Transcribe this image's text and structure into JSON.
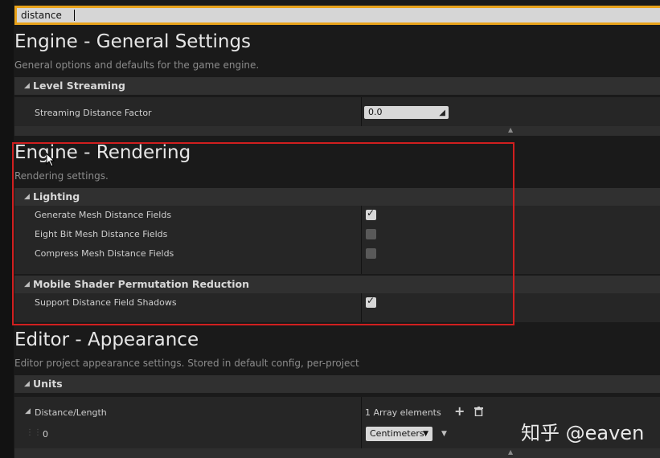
{
  "search": {
    "value": "distance"
  },
  "sections": [
    {
      "title": "Engine - General Settings",
      "description": "General options and defaults for the game engine.",
      "categories": [
        {
          "name": "Level Streaming",
          "rows": [
            {
              "label": "Streaming Distance Factor",
              "value": "0.0"
            }
          ]
        }
      ]
    },
    {
      "title": "Engine - Rendering",
      "description": "Rendering settings.",
      "categories": [
        {
          "name": "Lighting",
          "rows": [
            {
              "label": "Generate Mesh Distance Fields",
              "checked": true
            },
            {
              "label": "Eight Bit Mesh Distance Fields",
              "checked": false
            },
            {
              "label": "Compress Mesh Distance Fields",
              "checked": false
            }
          ]
        },
        {
          "name": "Mobile Shader Permutation Reduction",
          "rows": [
            {
              "label": "Support Distance Field Shadows",
              "checked": true
            }
          ]
        }
      ]
    },
    {
      "title": "Editor - Appearance",
      "description": "Editor project appearance settings. Stored in default config, per-project",
      "categories": [
        {
          "name": "Units",
          "rows": [
            {
              "label": "Distance/Length",
              "value": "1 Array elements"
            },
            {
              "label": "0",
              "value": "Centimeters"
            }
          ]
        }
      ]
    }
  ],
  "icons": {
    "collapse": "▲",
    "expand_row": "◢",
    "add": "plus-icon",
    "delete": "trash-icon",
    "dropdown": "chevron-down-icon"
  },
  "watermark": "知乎 @eaven",
  "colors": {
    "highlight": "#d01f1f",
    "search_border": "#e8a21a"
  }
}
